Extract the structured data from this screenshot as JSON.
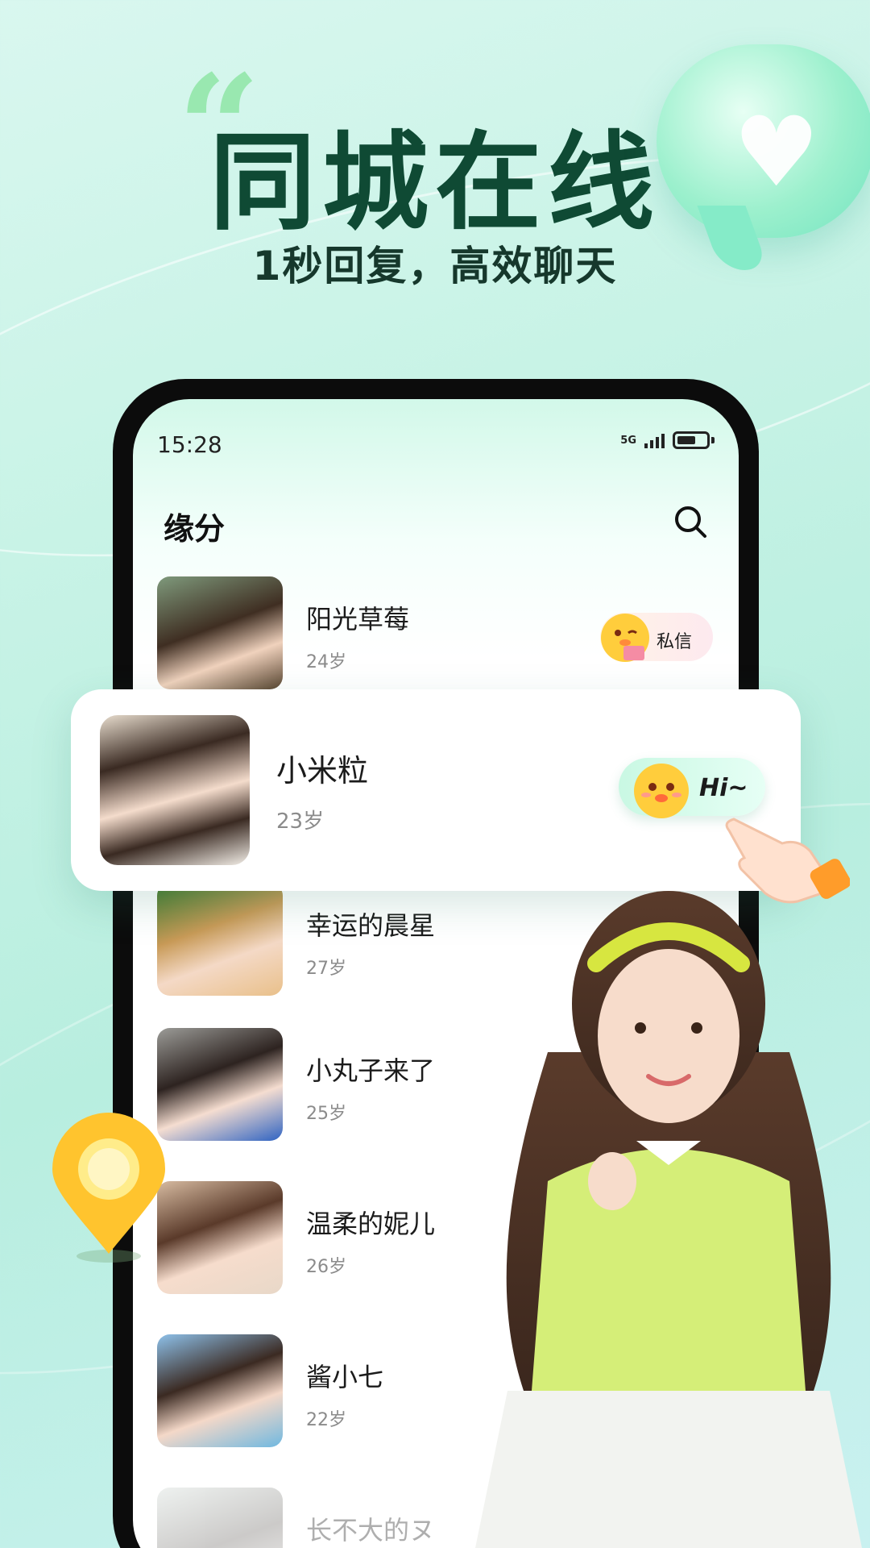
{
  "promo": {
    "headline": "同城在线",
    "subline": "1秒回复，高效聊天"
  },
  "status_bar": {
    "time": "15:28",
    "network": "5G"
  },
  "header": {
    "title": "缘分"
  },
  "list": [
    {
      "name": "阳光草莓",
      "age": "24岁",
      "action": "私信"
    },
    {
      "name": "幸运的晨星",
      "age": "27岁"
    },
    {
      "name": "小丸子来了",
      "age": "25岁"
    },
    {
      "name": "温柔的妮儿",
      "age": "26岁"
    },
    {
      "name": "酱小七",
      "age": "22岁"
    },
    {
      "name": "长不大的ヌ",
      "age": ""
    }
  ],
  "featured": {
    "name": "小米粒",
    "age": "23岁",
    "greeting": "Hi~"
  },
  "colors": {
    "headline": "#0f4a34",
    "accent_green": "#8fe6a6",
    "background": "#c8f3e6"
  },
  "icons": [
    "quote-icon",
    "heart-bubble-icon",
    "search-icon",
    "signal-icon",
    "battery-icon",
    "chick-emoji-icon",
    "pointing-hand-icon",
    "location-pin-icon"
  ]
}
